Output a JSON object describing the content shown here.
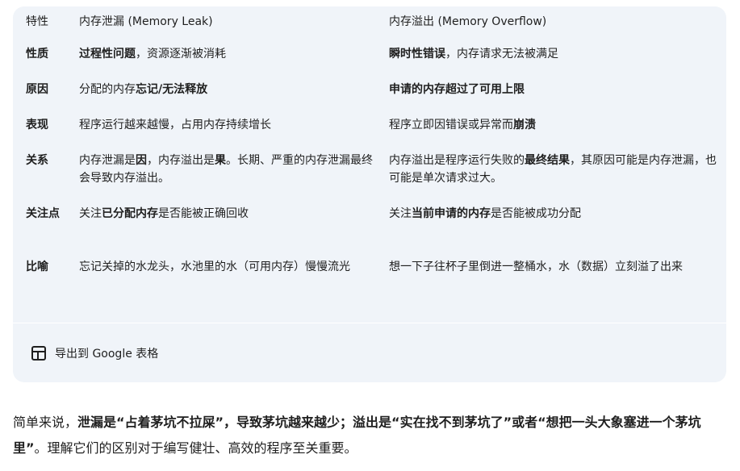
{
  "table": {
    "headers": [
      "特性",
      "内存泄漏 (Memory Leak)",
      "内存溢出 (Memory Overflow)"
    ],
    "rows": [
      {
        "label": "性质",
        "leak": [
          {
            "t": "过程性问题",
            "b": true
          },
          {
            "t": "，资源逐渐被消耗"
          }
        ],
        "overflow": [
          {
            "t": "瞬时性错误",
            "b": true
          },
          {
            "t": "，内存请求无法被满足"
          }
        ]
      },
      {
        "label": "原因",
        "leak": [
          {
            "t": "分配的内存"
          },
          {
            "t": "忘记/无法释放",
            "b": true
          }
        ],
        "overflow": [
          {
            "t": "申请的内存超过了可用上限",
            "b": true
          }
        ]
      },
      {
        "label": "表现",
        "leak": [
          {
            "t": "程序运行越来越慢，占用内存持续增长"
          }
        ],
        "overflow": [
          {
            "t": "程序立即因错误或异常而"
          },
          {
            "t": "崩溃",
            "b": true
          }
        ]
      },
      {
        "label": "关系",
        "leak": [
          {
            "t": "内存泄漏是"
          },
          {
            "t": "因",
            "b": true
          },
          {
            "t": "，内存溢出是"
          },
          {
            "t": "果",
            "b": true
          },
          {
            "t": "。长期、严重的内存泄漏最终会导致内存溢出。"
          }
        ],
        "overflow": [
          {
            "t": "内存溢出是程序运行失败的"
          },
          {
            "t": "最终结果",
            "b": true
          },
          {
            "t": "，其原因可能是内存泄漏，也可能是单次请求过大。"
          }
        ]
      },
      {
        "label": "关注点",
        "leak": [
          {
            "t": "关注"
          },
          {
            "t": "已分配内存",
            "b": true
          },
          {
            "t": "是否能被正确回收"
          }
        ],
        "overflow": [
          {
            "t": "关注"
          },
          {
            "t": "当前申请的内存",
            "b": true
          },
          {
            "t": "是否能被成功分配"
          }
        ]
      },
      {
        "label": "比喻",
        "leak": [
          {
            "t": "忘记关掉的水龙头，水池里的水（可用内存）慢慢流光"
          }
        ],
        "overflow": [
          {
            "t": "想一下子往杯子里倒进一整桶水，水（数据）立刻溢了出来"
          }
        ]
      }
    ]
  },
  "export": {
    "label": "导出到 Google 表格",
    "icon": "table-grid-icon"
  },
  "summary": [
    {
      "t": "简单来说，"
    },
    {
      "t": "泄漏是“占着茅坑不拉屎”，导致茅坑越来越少；溢出是“实在找不到茅坑了”或者“想把一头大象塞进一个茅坑里”",
      "b": true
    },
    {
      "t": "。理解它们的区别对于编写健壮、高效的程序至关重要。"
    }
  ]
}
